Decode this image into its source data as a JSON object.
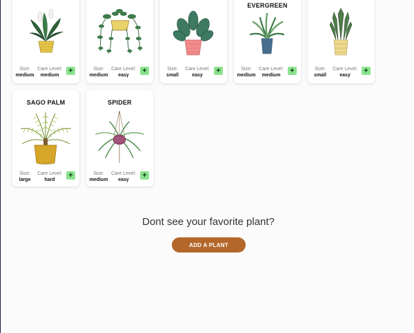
{
  "labels": {
    "size": "Size:",
    "care": "Care Level:",
    "add": "+"
  },
  "cards": [
    {
      "title": "",
      "size": "medium",
      "care": "medium",
      "icon": "peace-lily-plant-icon"
    },
    {
      "title": "",
      "size": "medium",
      "care": "easy",
      "icon": "pothos-plant-icon"
    },
    {
      "title": "",
      "size": "small",
      "care": "easy",
      "icon": "calathea-plant-icon"
    },
    {
      "title": "EVERGREEN",
      "size": "medium",
      "care": "medium",
      "icon": "evergreen-plant-icon"
    },
    {
      "title": "",
      "size": "small",
      "care": "easy",
      "icon": "snake-plant-icon"
    },
    {
      "title": "SAGO PALM",
      "size": "large",
      "care": "hard",
      "icon": "sago-palm-plant-icon"
    },
    {
      "title": "SPIDER",
      "size": "medium",
      "care": "easy",
      "icon": "spider-plant-icon"
    }
  ],
  "footer": {
    "prompt": "Dont see your favorite plant?",
    "button_label": "ADD A PLANT"
  },
  "colors": {
    "add_button": "#8be38f",
    "cta_button": "#b3672a"
  }
}
